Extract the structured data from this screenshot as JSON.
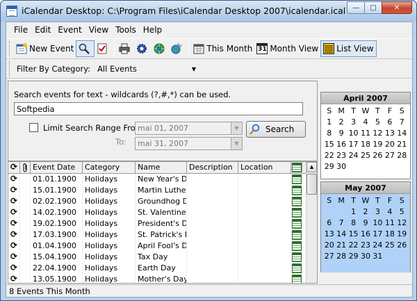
{
  "window": {
    "title": "iCalendar Desktop: C:\\Program Files\\iCalendar Desktop 2007\\icalendar.ical",
    "min_glyph": "—",
    "max_glyph": "□",
    "close_glyph": "✕"
  },
  "menu": [
    "File",
    "Edit",
    "Event",
    "View",
    "Tools",
    "Help"
  ],
  "toolbar": {
    "new_event": "New Event",
    "this_month": "This Month",
    "month_view": "Month View",
    "list_view": "List View",
    "month_icon_day": "31"
  },
  "filter": {
    "label": "Filter By Category:",
    "selected": "All Events",
    "arrow": "▼"
  },
  "search": {
    "hint": "Search events for text - wildcards (?,#,*) can be used.",
    "value": "Softpedia",
    "limit_label": "Limit Search Range From:",
    "from_date": "mai 01, 2007",
    "to_label": "To:",
    "to_date": "mai 31, 2007",
    "button": "Search",
    "arrow": "▼"
  },
  "table": {
    "columns": [
      "Event Date",
      "Category",
      "Name",
      "Description",
      "Location"
    ],
    "rows": [
      {
        "date": "01.01.1900",
        "category": "Holidays",
        "name": "New Year's Day"
      },
      {
        "date": "15.01.1900",
        "category": "Holidays",
        "name": "Martin Luther King"
      },
      {
        "date": "02.02.1900",
        "category": "Holidays",
        "name": "Groundhog Day"
      },
      {
        "date": "14.02.1900",
        "category": "Holidays",
        "name": "St. Valentine's"
      },
      {
        "date": "19.02.1900",
        "category": "Holidays",
        "name": "President's Day"
      },
      {
        "date": "17.03.1900",
        "category": "Holidays",
        "name": "St. Patrick's Day"
      },
      {
        "date": "01.04.1900",
        "category": "Holidays",
        "name": "April Fool's Day"
      },
      {
        "date": "15.04.1900",
        "category": "Holidays",
        "name": "Tax Day"
      },
      {
        "date": "22.04.1900",
        "category": "Holidays",
        "name": "Earth Day"
      },
      {
        "date": "13.05.1900",
        "category": "Holidays",
        "name": "Mother's Day"
      }
    ],
    "scroll_up": "▲"
  },
  "status": "8 Events This Month",
  "calendars": [
    {
      "title": "April 2007",
      "weekdays": [
        "S",
        "M",
        "T",
        "W",
        "T",
        "F",
        "S"
      ],
      "days": [
        "1",
        "2",
        "3",
        "4",
        "5",
        "6",
        "7",
        "8",
        "9",
        "10",
        "11",
        "12",
        "13",
        "14",
        "15",
        "16",
        "17",
        "18",
        "19",
        "20",
        "21",
        "22",
        "23",
        "24",
        "25",
        "26",
        "27",
        "28",
        "29",
        "30"
      ],
      "lead_blanks": 0,
      "selected": false
    },
    {
      "title": "May 2007",
      "weekdays": [
        "S",
        "M",
        "T",
        "W",
        "T",
        "F",
        "S"
      ],
      "days": [
        "1",
        "2",
        "3",
        "4",
        "5",
        "6",
        "7",
        "8",
        "9",
        "10",
        "11",
        "12",
        "13",
        "14",
        "15",
        "16",
        "17",
        "18",
        "19",
        "20",
        "21",
        "22",
        "23",
        "24",
        "25",
        "26",
        "27",
        "28",
        "29",
        "30",
        "31"
      ],
      "lead_blanks": 2,
      "selected": true
    }
  ]
}
